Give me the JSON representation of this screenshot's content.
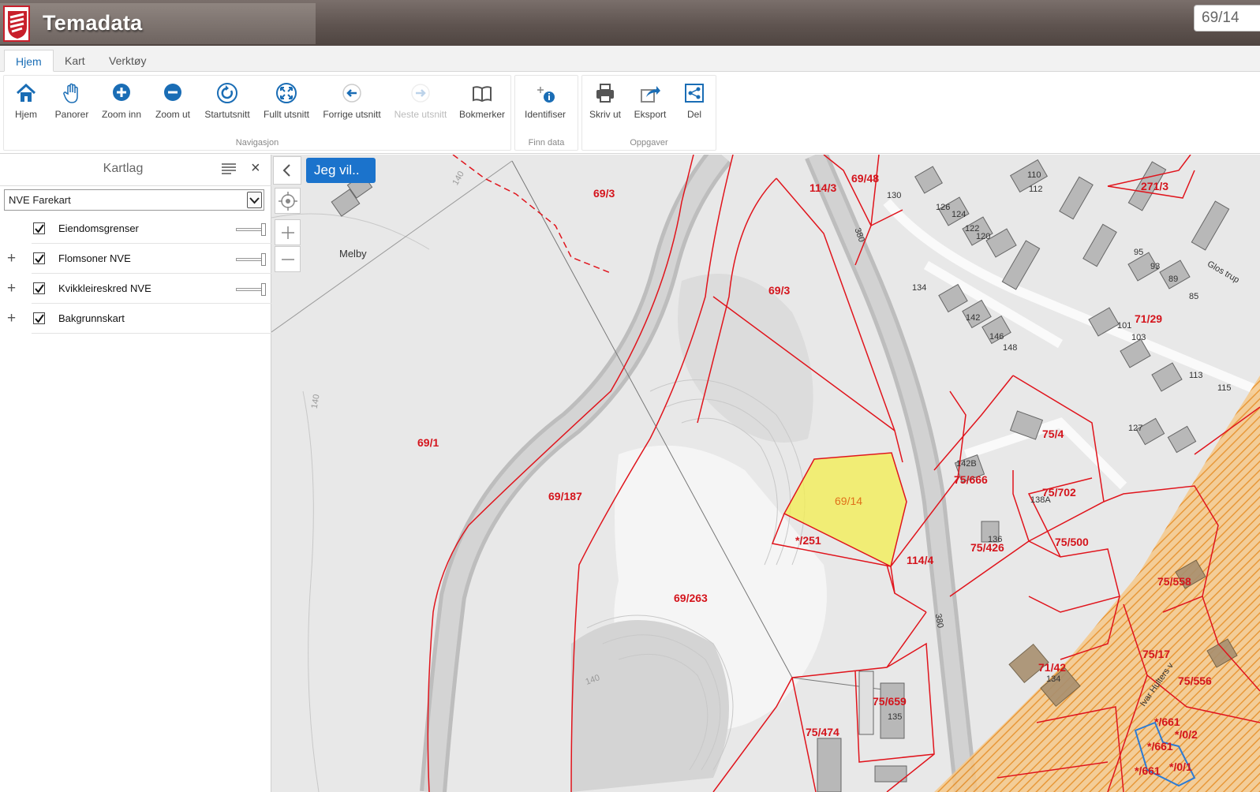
{
  "header": {
    "app_title": "Temadata",
    "search_value": "69/14"
  },
  "tabs": [
    {
      "label": "Hjem",
      "active": true
    },
    {
      "label": "Kart",
      "active": false
    },
    {
      "label": "Verktøy",
      "active": false
    }
  ],
  "ribbon": {
    "groups": [
      {
        "label": "Navigasjon",
        "buttons": [
          {
            "label": "Hjem",
            "icon": "home-icon"
          },
          {
            "label": "Panorer",
            "icon": "hand-icon"
          },
          {
            "label": "Zoom inn",
            "icon": "zoom-in-icon"
          },
          {
            "label": "Zoom ut",
            "icon": "zoom-out-icon"
          },
          {
            "label": "Startutsnitt",
            "icon": "refresh-icon"
          },
          {
            "label": "Fullt utsnitt",
            "icon": "fullscreen-icon"
          },
          {
            "label": "Forrige utsnitt",
            "icon": "back-arrow-icon"
          },
          {
            "label": "Neste utsnitt",
            "icon": "forward-arrow-icon",
            "disabled": true
          },
          {
            "label": "Bokmerker",
            "icon": "book-icon"
          }
        ]
      },
      {
        "label": "Finn data",
        "buttons": [
          {
            "label": "Identifiser",
            "icon": "identify-icon"
          }
        ]
      },
      {
        "label": "Oppgaver",
        "buttons": [
          {
            "label": "Skriv ut",
            "icon": "printer-icon"
          },
          {
            "label": "Eksport",
            "icon": "export-icon"
          },
          {
            "label": "Del",
            "icon": "share-icon"
          }
        ]
      }
    ]
  },
  "panel": {
    "title": "Kartlag",
    "select_value": "NVE Farekart",
    "layers": [
      {
        "name": "Eiendomsgrenser",
        "checked": true,
        "expandable": false,
        "slider": true
      },
      {
        "name": "Flomsoner NVE",
        "checked": true,
        "expandable": true,
        "slider": true
      },
      {
        "name": "Kvikkleireskred NVE",
        "checked": true,
        "expandable": true,
        "slider": true
      },
      {
        "name": "Bakgrunnskart",
        "checked": true,
        "expandable": true,
        "slider": false
      }
    ]
  },
  "map": {
    "action_button": "Jeg vil..",
    "place_name": "Melby",
    "selected_parcel": "69/14",
    "parcel_labels": [
      "69/3",
      "114/3",
      "69/48",
      "271/3",
      "69/3",
      "71/29",
      "69/1",
      "75/4",
      "75/666",
      "75/702",
      "69/187",
      "69/14",
      "*/251",
      "114/4",
      "75/426",
      "75/500",
      "69/263",
      "75/558",
      "75/17",
      "71/42",
      "75/556",
      "75/659",
      "75/474",
      "*/661",
      "*/0/2",
      "*/661",
      "*/661",
      "*/0/1"
    ],
    "house_numbers": [
      "130",
      "110",
      "112",
      "126",
      "124",
      "122",
      "120",
      "134",
      "142",
      "146",
      "148",
      "95",
      "93",
      "89",
      "85",
      "101",
      "103",
      "113",
      "115",
      "127",
      "142B",
      "138A",
      "136",
      "135",
      "134",
      "380",
      "380",
      "140",
      "140",
      "140"
    ],
    "road_labels": [
      "Glos trup",
      "Ivar Hulters v"
    ],
    "colors": {
      "parcel_line": "#e0141c",
      "selection": "#f2ee57",
      "hazard": "#f0a030"
    }
  }
}
